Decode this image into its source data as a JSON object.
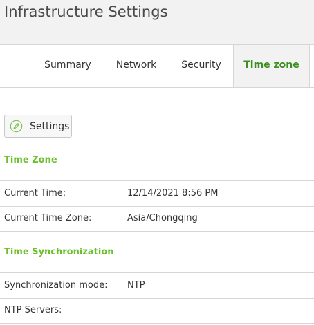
{
  "header": {
    "title": "Infrastructure Settings"
  },
  "tabs": [
    {
      "label": "Summary",
      "active": false
    },
    {
      "label": "Network",
      "active": false
    },
    {
      "label": "Security",
      "active": false
    },
    {
      "label": "Time zone",
      "active": true
    }
  ],
  "toolbar": {
    "settings_label": "Settings",
    "settings_icon": "edit-pencil-circle-icon"
  },
  "colors": {
    "accent_green": "#6cc02c",
    "active_tab_text": "#3d8f1f",
    "header_bg": "#f2f2f2"
  },
  "time_zone": {
    "title": "Time Zone",
    "rows": [
      {
        "key": "Current Time:",
        "value": "12/14/2021 8:56 PM"
      },
      {
        "key": "Current Time Zone:",
        "value": "Asia/Chongqing"
      }
    ]
  },
  "time_sync": {
    "title": "Time Synchronization",
    "rows": [
      {
        "key": "Synchronization mode:",
        "value": "NTP"
      },
      {
        "key": "NTP Servers:",
        "value": ""
      }
    ]
  }
}
